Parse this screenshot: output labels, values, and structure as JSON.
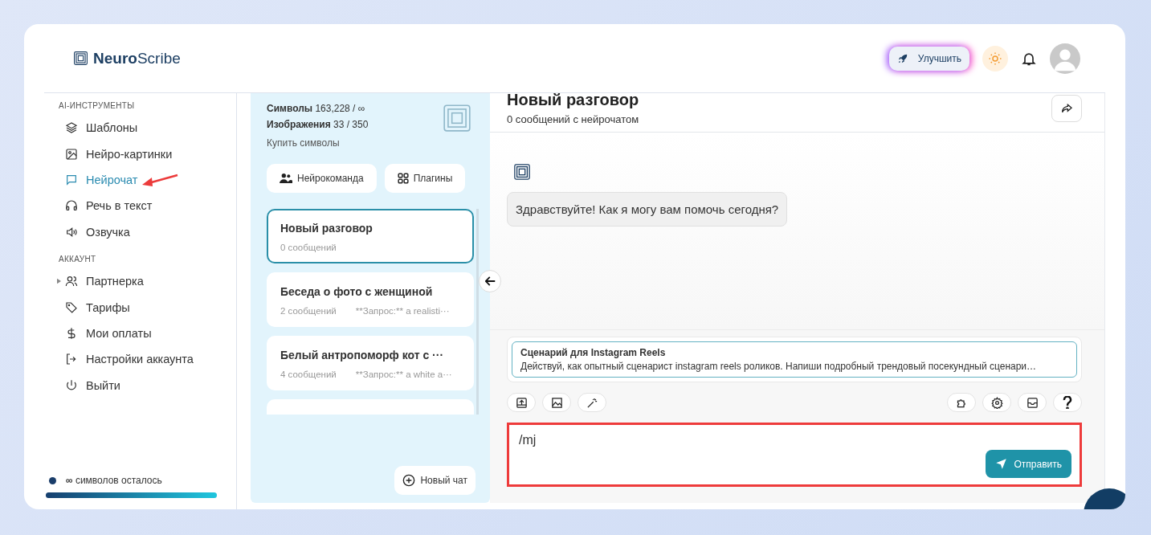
{
  "header": {
    "logo_bold": "Neuro",
    "logo_rest": "Scribe",
    "upgrade_button": "Улучшить"
  },
  "sidebar": {
    "sections": [
      {
        "title": "AI-ИНСТРУМЕНТЫ",
        "items": [
          {
            "label": "Шаблоны",
            "selected": false
          },
          {
            "label": "Нейро-картинки",
            "selected": false
          },
          {
            "label": "Нейрочат",
            "selected": true,
            "annotated": true
          },
          {
            "label": "Речь в текст",
            "selected": false
          },
          {
            "label": "Озвучка",
            "selected": false
          }
        ]
      },
      {
        "title": "АККАУНТ",
        "items": [
          {
            "label": "Партнерка",
            "selected": false,
            "expanded": false
          },
          {
            "label": "Тарифы",
            "selected": false
          },
          {
            "label": "Мои оплаты",
            "selected": false
          },
          {
            "label": "Настройки аккаунта",
            "selected": false
          },
          {
            "label": "Выйти",
            "selected": false
          }
        ]
      }
    ],
    "balance": {
      "symbol": "∞",
      "text": "символов осталось",
      "level": 1
    }
  },
  "chat_panel": {
    "symbols_label": "Символы",
    "symbols_value": "163,228 / ∞",
    "images_label": "Изображения",
    "images_value": "33 / 350",
    "buy_link": "Купить символы",
    "buttons": [
      {
        "label": "Нейрокоманда"
      },
      {
        "label": "Плагины"
      }
    ],
    "chats": [
      {
        "title": "Новый разговор",
        "count": "0 сообщений",
        "selected": true
      },
      {
        "title": "Беседа о фото с женщиной",
        "count": "2 сообщений",
        "preview": "**Запрос:** a realisti···",
        "selected": false
      },
      {
        "title": "Белый антропоморф кот с ···",
        "count": "4 сообщений",
        "preview": "**Запрос:** a white a···",
        "selected": false
      }
    ],
    "new_chat": "Новый чат"
  },
  "conversation": {
    "title": "Новый разговор",
    "subtitle": "0 сообщений с нейрочатом",
    "messages": [
      {
        "text": "Здравствуйте! Как я могу вам помочь сегодня?"
      }
    ],
    "template": {
      "title": "Сценарий для Instagram Reels",
      "text": "Действуй, как опытный сценарист instagram reels роликов. Напиши подробный трендовый посекундный сценари…"
    },
    "input": {
      "value": "/mj",
      "highlighted": true
    },
    "send_button": "Отправить"
  }
}
